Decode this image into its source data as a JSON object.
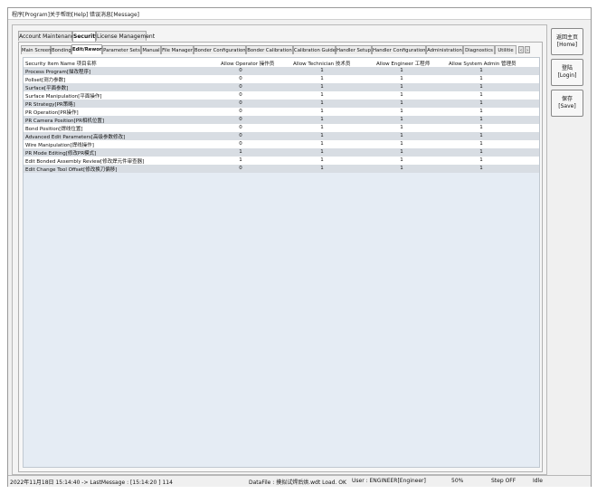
{
  "menu": [
    "程序[Program]",
    "关于帮助[Help]",
    "错误消息[Message]"
  ],
  "top_tabs": [
    {
      "label": "Account Maintenance",
      "active": false
    },
    {
      "label": "Security",
      "active": true
    },
    {
      "label": "License Management",
      "active": false
    }
  ],
  "sub_tabs": [
    {
      "label": "Main Screen",
      "active": false
    },
    {
      "label": "Bonding",
      "active": false
    },
    {
      "label": "Edit/Rework",
      "active": true
    },
    {
      "label": "Parameter Sets",
      "active": false
    },
    {
      "label": "Manual",
      "active": false
    },
    {
      "label": "File Manager",
      "active": false
    },
    {
      "label": "Bonder Configuration",
      "active": false
    },
    {
      "label": "Bonder Calibration",
      "active": false
    },
    {
      "label": "Calibration Guide",
      "active": false
    },
    {
      "label": "Handler Setup",
      "active": false
    },
    {
      "label": "Handler Configuration",
      "active": false
    },
    {
      "label": "Administration",
      "active": false
    },
    {
      "label": "Diagnostics",
      "active": false
    },
    {
      "label": "Utilitie",
      "active": false
    }
  ],
  "table": {
    "columns": [
      "Security Item Name 项目名称",
      "Allow Operator 操作员",
      "Allow Technician 技术员",
      "Allow Engineer 工程师",
      "Allow System Admin 管理员"
    ],
    "rows": [
      {
        "name": "Process Program[描改程序]",
        "op": "0",
        "tech": "1",
        "eng": "1",
        "admin": "1"
      },
      {
        "name": "Pollset[测力参数]",
        "op": "0",
        "tech": "1",
        "eng": "1",
        "admin": "1"
      },
      {
        "name": "Surface[平面参数]",
        "op": "0",
        "tech": "1",
        "eng": "1",
        "admin": "1"
      },
      {
        "name": "Surface Manipulation[平面操作]",
        "op": "0",
        "tech": "1",
        "eng": "1",
        "admin": "1"
      },
      {
        "name": "PR Strategy[PR策略]",
        "op": "0",
        "tech": "1",
        "eng": "1",
        "admin": "1"
      },
      {
        "name": "PR Operation[PR操作]",
        "op": "0",
        "tech": "1",
        "eng": "1",
        "admin": "1"
      },
      {
        "name": "PR Camera Position[PR相机位置]",
        "op": "0",
        "tech": "1",
        "eng": "1",
        "admin": "1"
      },
      {
        "name": "Bond Position[焊线位置]",
        "op": "0",
        "tech": "1",
        "eng": "1",
        "admin": "1"
      },
      {
        "name": "Advanced Edit Parameters[高级参数修改]",
        "op": "0",
        "tech": "1",
        "eng": "1",
        "admin": "1"
      },
      {
        "name": "Wire Manipulation[焊线操作]",
        "op": "0",
        "tech": "1",
        "eng": "1",
        "admin": "1"
      },
      {
        "name": "PR Mode Editing[修改PR模式]",
        "op": "1",
        "tech": "1",
        "eng": "1",
        "admin": "1"
      },
      {
        "name": "Edit Bonded Assembly Review[修改焊元件审查器]",
        "op": "1",
        "tech": "1",
        "eng": "1",
        "admin": "1"
      },
      {
        "name": "Edit Change Tool Offset[修改换刀偏移]",
        "op": "0",
        "tech": "1",
        "eng": "1",
        "admin": "1"
      }
    ]
  },
  "side_buttons": [
    {
      "line1": "返回主页",
      "line2": "[Home]"
    },
    {
      "line1": "登陆",
      "line2": "[Login]"
    },
    {
      "line1": "保存",
      "line2": "[Save]"
    }
  ],
  "status": {
    "datetime": "2022年11月18日 15:14:40 -> LastMessage : [15:14:20 ] 114",
    "datafile": "DataFile : 摸拟试焊后烘.wdt Load. OK",
    "user": "User : ENGINEER[Engineer]",
    "percent": "50%",
    "step": "Step OFF",
    "state": "Idle"
  }
}
